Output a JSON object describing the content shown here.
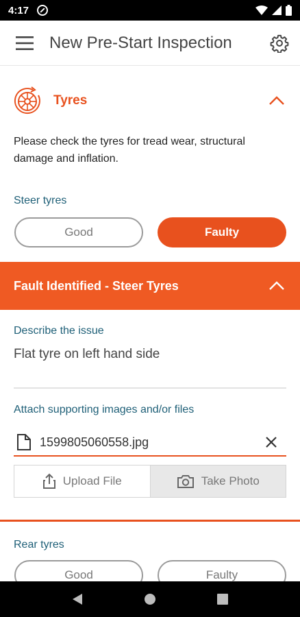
{
  "status_bar": {
    "time": "4:17"
  },
  "app_bar": {
    "title": "New Pre-Start Inspection"
  },
  "tyres_section": {
    "title": "Tyres",
    "instructions": "Please check the tyres for tread wear, structural damage and inflation.",
    "steer": {
      "label": "Steer tyres",
      "good_label": "Good",
      "faulty_label": "Faulty",
      "selected": "Faulty"
    },
    "fault": {
      "title": "Fault Identified - Steer Tyres",
      "describe_label": "Describe the issue",
      "describe_value": "Flat tyre on left hand side",
      "attach_label": "Attach supporting images and/or files",
      "attached_file": "1599805060558.jpg",
      "upload_label": "Upload File",
      "photo_label": "Take Photo"
    },
    "rear": {
      "label": "Rear tyres",
      "good_label": "Good",
      "faulty_label": "Faulty"
    }
  },
  "colors": {
    "accent": "#e8511e",
    "label": "#1e5f77"
  },
  "icons": [
    "menu-icon",
    "gear-icon",
    "tyre-icon",
    "chevron-up-icon",
    "document-icon",
    "close-icon",
    "upload-icon",
    "camera-icon"
  ]
}
